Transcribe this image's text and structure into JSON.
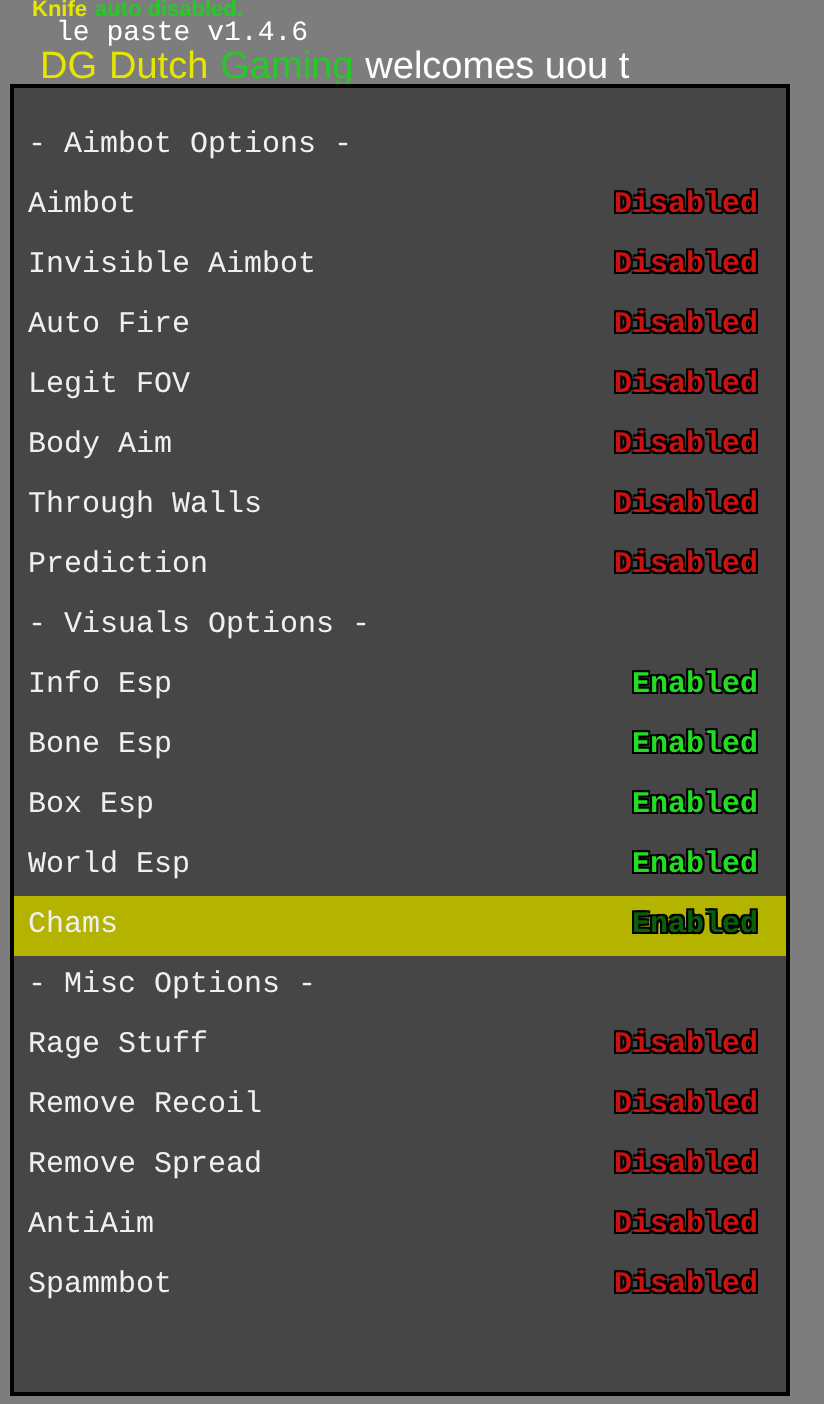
{
  "hud": {
    "notice": [
      {
        "text": "Knife",
        "kind": "yellow"
      },
      {
        "text": "auto disabled.",
        "kind": "green"
      }
    ],
    "version": "le paste v1.4.6",
    "welcome": [
      {
        "text": "DG",
        "kind": "yellow"
      },
      {
        "text": "Dutch",
        "kind": "yellow"
      },
      {
        "text": "Gaming",
        "kind": "green"
      },
      {
        "text": "welcomes uou t",
        "kind": "white"
      }
    ]
  },
  "menu": {
    "items": [
      {
        "kind": "header",
        "label": "- Aimbot Options -"
      },
      {
        "kind": "option",
        "label": "Aimbot",
        "status": "Disabled",
        "enabled": false,
        "selected": false
      },
      {
        "kind": "option",
        "label": "Invisible Aimbot",
        "status": "Disabled",
        "enabled": false,
        "selected": false
      },
      {
        "kind": "option",
        "label": "Auto Fire",
        "status": "Disabled",
        "enabled": false,
        "selected": false
      },
      {
        "kind": "option",
        "label": "Legit FOV",
        "status": "Disabled",
        "enabled": false,
        "selected": false
      },
      {
        "kind": "option",
        "label": "Body Aim",
        "status": "Disabled",
        "enabled": false,
        "selected": false
      },
      {
        "kind": "option",
        "label": "Through Walls",
        "status": "Disabled",
        "enabled": false,
        "selected": false
      },
      {
        "kind": "option",
        "label": "Prediction",
        "status": "Disabled",
        "enabled": false,
        "selected": false
      },
      {
        "kind": "header",
        "label": "- Visuals Options -"
      },
      {
        "kind": "option",
        "label": "Info Esp",
        "status": "Enabled",
        "enabled": true,
        "selected": false
      },
      {
        "kind": "option",
        "label": "Bone Esp",
        "status": "Enabled",
        "enabled": true,
        "selected": false
      },
      {
        "kind": "option",
        "label": "Box Esp",
        "status": "Enabled",
        "enabled": true,
        "selected": false
      },
      {
        "kind": "option",
        "label": "World Esp",
        "status": "Enabled",
        "enabled": true,
        "selected": false
      },
      {
        "kind": "option",
        "label": "Chams",
        "status": "Enabled",
        "enabled": true,
        "selected": true
      },
      {
        "kind": "header",
        "label": "- Misc Options -"
      },
      {
        "kind": "option",
        "label": "Rage Stuff",
        "status": "Disabled",
        "enabled": false,
        "selected": false
      },
      {
        "kind": "option",
        "label": "Remove Recoil",
        "status": "Disabled",
        "enabled": false,
        "selected": false
      },
      {
        "kind": "option",
        "label": "Remove Spread",
        "status": "Disabled",
        "enabled": false,
        "selected": false
      },
      {
        "kind": "option",
        "label": "AntiAim",
        "status": "Disabled",
        "enabled": false,
        "selected": false
      },
      {
        "kind": "option",
        "label": "Spammbot",
        "status": "Disabled",
        "enabled": false,
        "selected": false
      }
    ]
  }
}
